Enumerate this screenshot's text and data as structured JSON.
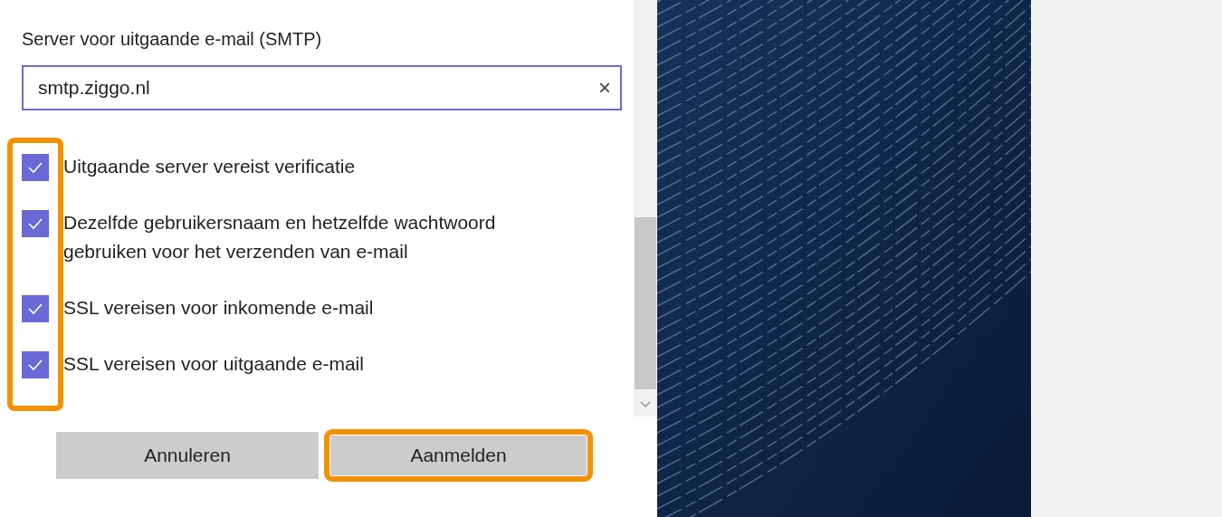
{
  "field": {
    "label": "Server voor uitgaande e-mail (SMTP)",
    "value": "smtp.ziggo.nl",
    "clear": "×"
  },
  "options": {
    "highlighted": true,
    "items": [
      {
        "label": "Uitgaande server vereist verificatie",
        "checked": true
      },
      {
        "label": "Dezelfde gebruikersnaam en hetzelfde wachtwoord gebruiken voor het verzenden van e-mail",
        "checked": true
      },
      {
        "label": "SSL vereisen voor inkomende e-mail",
        "checked": true
      },
      {
        "label": "SSL vereisen voor uitgaande e-mail",
        "checked": true
      }
    ]
  },
  "buttons": [
    {
      "label": "Annuleren",
      "highlighted": false
    },
    {
      "label": "Aanmelden",
      "highlighted": true
    }
  ]
}
